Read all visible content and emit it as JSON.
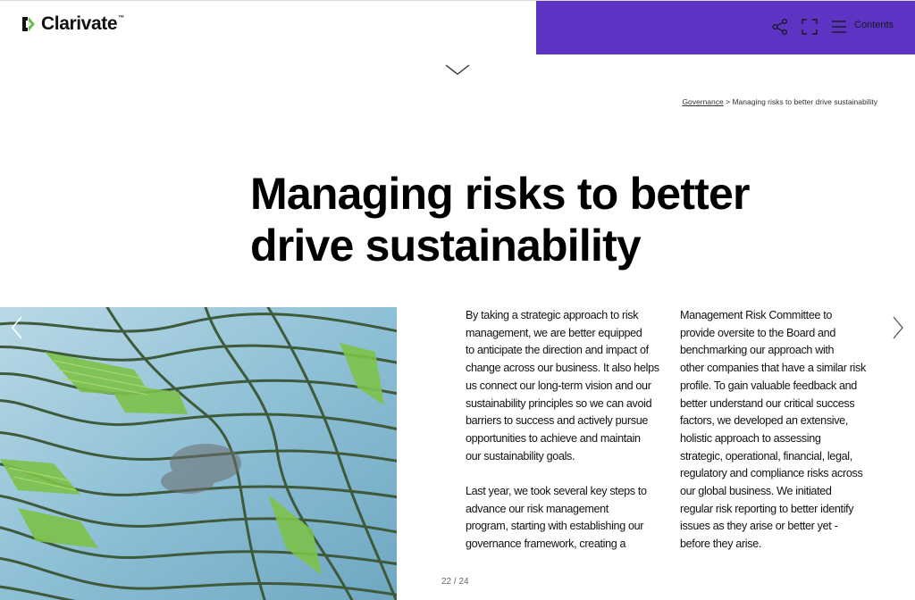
{
  "brand": {
    "name": "Clarivate",
    "trademark": "™"
  },
  "toolbar": {
    "background_color": "#5c33c2",
    "share_icon": "share-icon",
    "expand_icon": "fullscreen-icon",
    "menu_icon": "hamburger-menu-icon",
    "contents_label": "Contents"
  },
  "breadcrumb": {
    "parent": "Governance",
    "separator": ">",
    "current": "Managing risks to better drive sustainability"
  },
  "page": {
    "title_line_1": "Managing risks to better",
    "title_line_2": "drive sustainability"
  },
  "body": {
    "column_1": [
      {
        "lines": [
          "By taking a strategic approach to risk",
          "management, we are better equipped",
          "to anticipate the direction and impact of",
          "change across our business. It also helps",
          "us connect our long-term vision and our",
          "sustainability principles so we can avoid",
          "barriers to success and actively pursue",
          "opportunities to achieve and maintain",
          "our sustainability goals."
        ]
      },
      {
        "lines": [
          "Last year, we took several key steps to",
          "advance our risk management",
          "program, starting with establishing our",
          "governance framework, creating a"
        ]
      }
    ],
    "column_2": [
      {
        "lines": [
          "Management Risk Committee to",
          "provide oversite to the Board and",
          "benchmarking our approach with",
          "other companies that have a similar risk",
          "profile. To gain valuable feedback and",
          "better understand our critical success",
          "factors, we developed an extensive,",
          "holistic approach to assessing",
          "strategic, operational, financial, legal,",
          "regulatory and compliance risks across",
          "our global business. We initiated",
          "regular risk reporting to better identify",
          "issues as they arise or better yet -",
          "before they arise."
        ]
      }
    ]
  },
  "navigation": {
    "prev_icon": "chevron-left-icon",
    "next_icon": "chevron-right-icon",
    "current_page": "22",
    "separator": "/",
    "total_pages": "24"
  },
  "image": {
    "subject": "rice-terraces-photo"
  }
}
